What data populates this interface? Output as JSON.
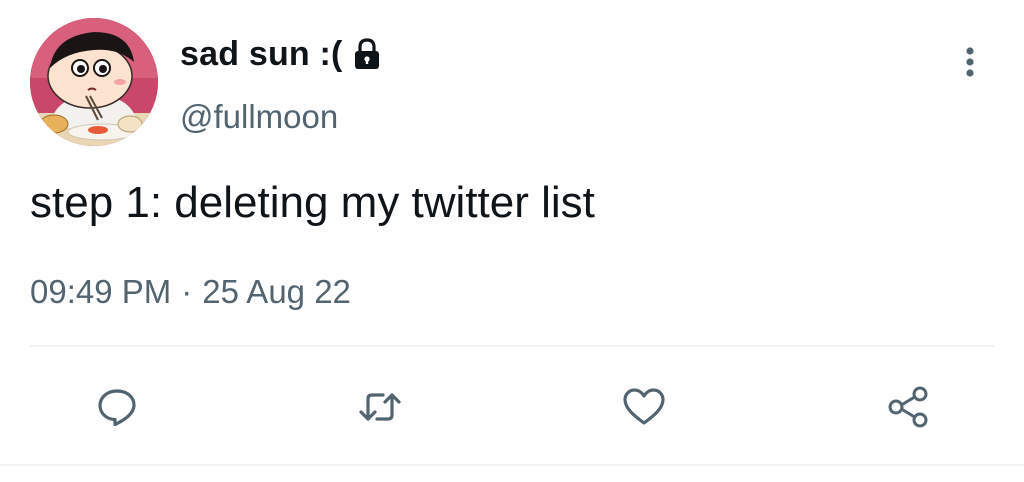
{
  "author": {
    "display_name": "sad sun :(",
    "handle": "@fullmoon",
    "protected_icon": "lock-icon",
    "avatar_icon": "cartoon-boy-avatar"
  },
  "tweet": {
    "text": "step 1: deleting my twitter list",
    "time": "09:49 PM",
    "separator": "·",
    "date": "25 Aug 22"
  },
  "actions": {
    "more": "more-options-icon",
    "reply": "reply-icon",
    "retweet": "retweet-icon",
    "like": "heart-icon",
    "share": "share-icon"
  },
  "colors": {
    "text_primary": "#0f1419",
    "text_secondary": "#536471",
    "icon_gray": "#536471",
    "divider": "#eff3f4"
  }
}
